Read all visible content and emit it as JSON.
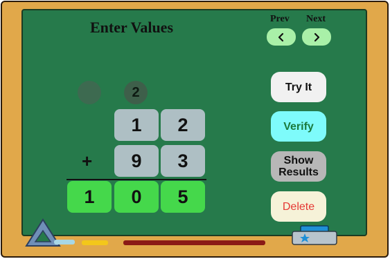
{
  "header": {
    "title": "Enter Values",
    "prev_label": "Prev",
    "next_label": "Next"
  },
  "problem": {
    "carry": "2",
    "top_row": [
      "1",
      "2"
    ],
    "operator": "+",
    "bottom_row": [
      "9",
      "3"
    ],
    "result_row": [
      "1",
      "0",
      "5"
    ]
  },
  "actions": {
    "try_it": "Try It",
    "verify": "Verify",
    "show_results": "Show Results",
    "delete": "Delete"
  },
  "icons": {
    "prev": "chevron-left-icon",
    "next": "chevron-right-icon",
    "set_square": "triangle-ruler-icon",
    "eraser": "eraser-icon"
  },
  "colors": {
    "board": "#267a4b",
    "frame": "#e1a84a",
    "input_cell": "#aebfc4",
    "result_cell": "#45d84b",
    "nav_button": "#a9f0a8",
    "try_it_bg": "#f1f1f1",
    "verify_bg": "#7efbfb",
    "verify_text": "#1b7a3c",
    "show_results_bg": "#b7b7b7",
    "delete_bg": "#f6f2d8",
    "delete_text": "#e53935"
  }
}
